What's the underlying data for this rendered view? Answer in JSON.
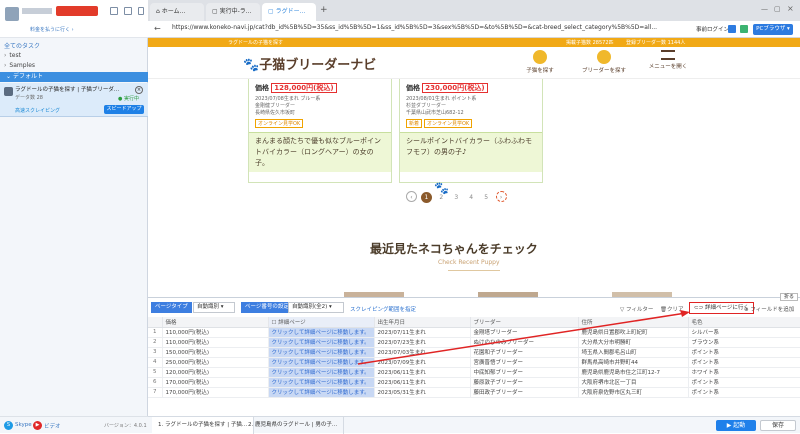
{
  "sidebar": {
    "account_link": "料金を払うに行く ›",
    "all_tasks": "全てのタスク",
    "folders": [
      "test",
      "Samples"
    ],
    "default_folder": "デフォルト",
    "task": {
      "name": "ラグドールの子猫を探す | 子猫ブリーダ...",
      "meta_prefix": "データ数",
      "count": "28",
      "status": "● 実行中",
      "cloud_label": "高速スクレイピング",
      "speed_button": "スピードアップ"
    },
    "footer": {
      "skype": "Skype",
      "video": "ビデオ",
      "version": "バージョン：4.0.1"
    }
  },
  "browser": {
    "tabs": [
      "ホーム...",
      "実行中-ラ...",
      "ラグドー..."
    ],
    "url": "https://www.koneko-navi.jp/cat?db_id%5B%5D=35&ss_id%5B%5D=1&ss_id%5B%5D=3&sex%5B%5D=&to%5B%5D=&cat-breed_select_category%5B%5D=all...",
    "login": "事前ログイン",
    "pc_browser": "PCブラウザ ▾"
  },
  "site": {
    "top_left": "ラグドールの子猫を探す",
    "top_right_1": "掲載子猫数 28572匹",
    "top_right_2": "登録ブリーダー数 1144人",
    "logo": "子猫ブリーダーナビ",
    "nav": [
      "子猫を探す",
      "ブリーダーを探す",
      "メニューを開く"
    ],
    "cards": [
      {
        "price_label": "価格",
        "price": "128,000円(税込)",
        "born": "2023/07/08生まれ",
        "sex": "ブルー系",
        "name": "金剛健ブリーダー",
        "loc": "長崎県佐久市坂町",
        "tag": "オンライン見学OK",
        "desc": "まんまる顔たちで優も似なブルーポイントバイカラー（ロングヘアー）の女の子。"
      },
      {
        "price_label": "価格",
        "price": "230,000円(税込)",
        "born": "2023/08/01生まれ",
        "sex": "ポイント系",
        "name": "杉並ダブリーダー",
        "loc": "千葉県山武市芝山682-12",
        "tag": "オンライン見学OK",
        "tag2": "新着",
        "desc": "シールポイントバイカラー（ふわふわモフモフ）の男の子♪"
      }
    ],
    "pager": [
      "‹",
      "1",
      "2",
      "3",
      "4",
      "5",
      "›"
    ],
    "recent_title": "最近見たネコちゃんをチェック",
    "recent_sub": "Check Recent Puppy"
  },
  "panel": {
    "page_type_label": "ページタイプ",
    "page_type_value": "自動識別",
    "page_count_label": "ページ番号の設定",
    "page_count_value": "自動識別(全2)",
    "scrape_link": "スクレイピング範囲を指定",
    "filter": "フィルター",
    "clear": "クリア",
    "detail_button": "詳細ページに行く",
    "add_field": "フィールドを追加",
    "fold": "折る",
    "columns": [
      "",
      "価格",
      "詳細ページ",
      "出生年月日",
      "ブリーダー",
      "住所",
      "毛色"
    ],
    "rows": [
      [
        "1",
        "110,000円(税込)",
        "クリックして詳細ページに移動します。",
        "2023/07/11生まれ",
        "金剛塔ブリーダー",
        "鹿児島県日置郡吹上町紀町",
        "シルバー系"
      ],
      [
        "2",
        "110,000円(税込)",
        "クリックして詳細ページに移動します。",
        "2023/07/23生まれ",
        "ぬけのひのみブリーダー",
        "大分県大分市明勝町",
        "ブラウン系"
      ],
      [
        "3",
        "150,000円(税込)",
        "クリックして詳細ページに移動します。",
        "2023/07/03生まれ",
        "花園和子ブリーダー",
        "埼玉県入間郡毛呂山町",
        "ポイント系"
      ],
      [
        "4",
        "250,000円(税込)",
        "クリックして詳細ページに移動します。",
        "2023/07/09生まれ",
        "宮廣晋悟ブリーダー",
        "群馬県高崎市井野町44",
        "ポイント系"
      ],
      [
        "5",
        "120,000円(税込)",
        "クリックして詳細ページに移動します。",
        "2023/06/11生まれ",
        "中底知郁ブリーダー",
        "鹿児島県鹿児島市住之江町12-7",
        "ホワイト系"
      ],
      [
        "6",
        "170,000円(税込)",
        "クリックして詳細ページに移動します。",
        "2023/06/11生まれ",
        "藤原敦子ブリーダー",
        "大阪府堺市北区一丁目",
        "ポイント系"
      ],
      [
        "7",
        "170,000円(税込)",
        "クリックして詳細ページに移動します。",
        "2023/05/31生まれ",
        "藤田政子ブリーダー",
        "大阪府泉佐野市区丸三町",
        "ポイント系"
      ]
    ]
  },
  "bottom": {
    "tabs": [
      "1. ラグドールの子猫を探す | 子猫...",
      "2. 鹿児島県のラグドール | 男の子..."
    ],
    "start": "▶ 起動",
    "save": "保存"
  }
}
